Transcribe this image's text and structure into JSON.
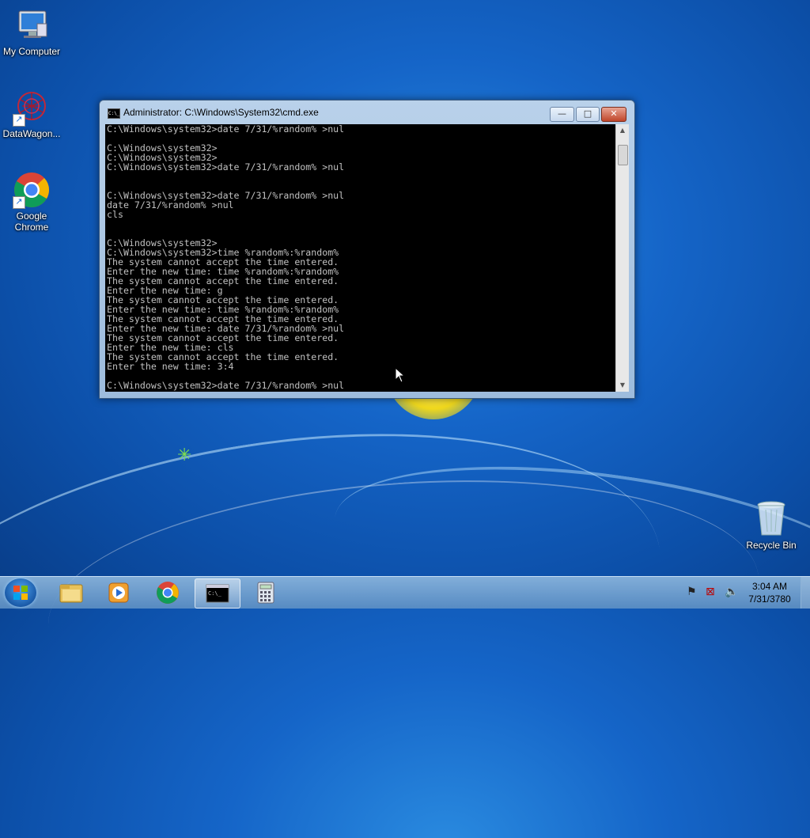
{
  "desktop": {
    "icons": [
      {
        "label": "My Computer",
        "icon": "computer-icon"
      },
      {
        "label": "DataWagon...",
        "icon": "datawagon-icon"
      },
      {
        "label": "Google Chrome",
        "icon": "chrome-icon"
      },
      {
        "label": "Recycle Bin",
        "icon": "recycle-bin-icon"
      }
    ]
  },
  "window": {
    "title": "Administrator: C:\\Windows\\System32\\cmd.exe",
    "title_icon_text": "C:\\_",
    "buttons": {
      "minimize": "—",
      "maximize": "□",
      "close": "✕"
    },
    "console_lines": [
      "C:\\Windows\\system32>date 7/31/%random% >nul",
      "",
      "C:\\Windows\\system32>",
      "C:\\Windows\\system32>",
      "C:\\Windows\\system32>date 7/31/%random% >nul",
      "",
      "",
      "C:\\Windows\\system32>date 7/31/%random% >nul",
      "date 7/31/%random% >nul",
      "cls",
      "",
      "",
      "C:\\Windows\\system32>",
      "C:\\Windows\\system32>time %random%:%random%",
      "The system cannot accept the time entered.",
      "Enter the new time: time %random%:%random%",
      "The system cannot accept the time entered.",
      "Enter the new time: g",
      "The system cannot accept the time entered.",
      "Enter the new time: time %random%:%random%",
      "The system cannot accept the time entered.",
      "Enter the new time: date 7/31/%random% >nul",
      "The system cannot accept the time entered.",
      "Enter the new time: cls",
      "The system cannot accept the time entered.",
      "Enter the new time: 3:4",
      "",
      "C:\\Windows\\system32>date 7/31/%random% >nul"
    ]
  },
  "taskbar": {
    "buttons": [
      {
        "name": "start-button",
        "icon": "windows-logo-icon"
      },
      {
        "name": "explorer-button",
        "icon": "folder-icon"
      },
      {
        "name": "media-player-button",
        "icon": "media-player-icon"
      },
      {
        "name": "chrome-button",
        "icon": "chrome-icon"
      },
      {
        "name": "cmd-button",
        "icon": "cmd-icon",
        "active": true
      },
      {
        "name": "calculator-button",
        "icon": "calculator-icon"
      }
    ],
    "tray_icons": [
      "action-center-icon",
      "network-icon",
      "volume-icon"
    ],
    "clock": {
      "time": "3:04 AM",
      "date": "7/31/3780"
    }
  },
  "colors": {
    "console_bg": "#000000",
    "console_fg": "#c0c0c0",
    "taskbar": "#6f9cc9"
  }
}
